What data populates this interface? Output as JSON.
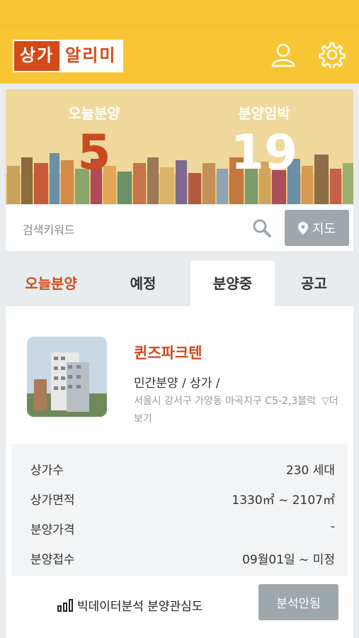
{
  "app": {
    "logo_part1": "상가",
    "logo_part2": "알리미"
  },
  "header": {
    "user_icon": "user-icon",
    "settings_icon": "gear-icon"
  },
  "banner": {
    "today_label": "오늘분양",
    "today_count": "5",
    "imminent_label": "분양임박",
    "imminent_count": "19"
  },
  "search": {
    "placeholder": "검색키워드",
    "map_label": "지도"
  },
  "tabs": [
    {
      "label": "오늘분양",
      "color": "#d24a17"
    },
    {
      "label": "예정"
    },
    {
      "label": "분양중",
      "active": true
    },
    {
      "label": "공고"
    }
  ],
  "listing": {
    "name": "퀸즈파크텐",
    "type": "민간분양 / 상가 /",
    "address": "서울시 강서구 가양동 마곡지구 C5-2,3블럭",
    "more_label": "▽더보기",
    "info": [
      {
        "label": "상가수",
        "value": "230 세대"
      },
      {
        "label": "상가면적",
        "value": "1330㎡ ~ 2107㎡"
      },
      {
        "label": "분양가격",
        "value": "-"
      },
      {
        "label": "분양접수",
        "value": "09월01일 ~ 미정"
      }
    ],
    "bigdata_label": "빅데이터분석 분양관심도",
    "analysis_button": "분석안됨"
  },
  "colors": {
    "header": "#f8c634",
    "accent": "#d24a17",
    "button_gray": "#9ea7ac"
  }
}
